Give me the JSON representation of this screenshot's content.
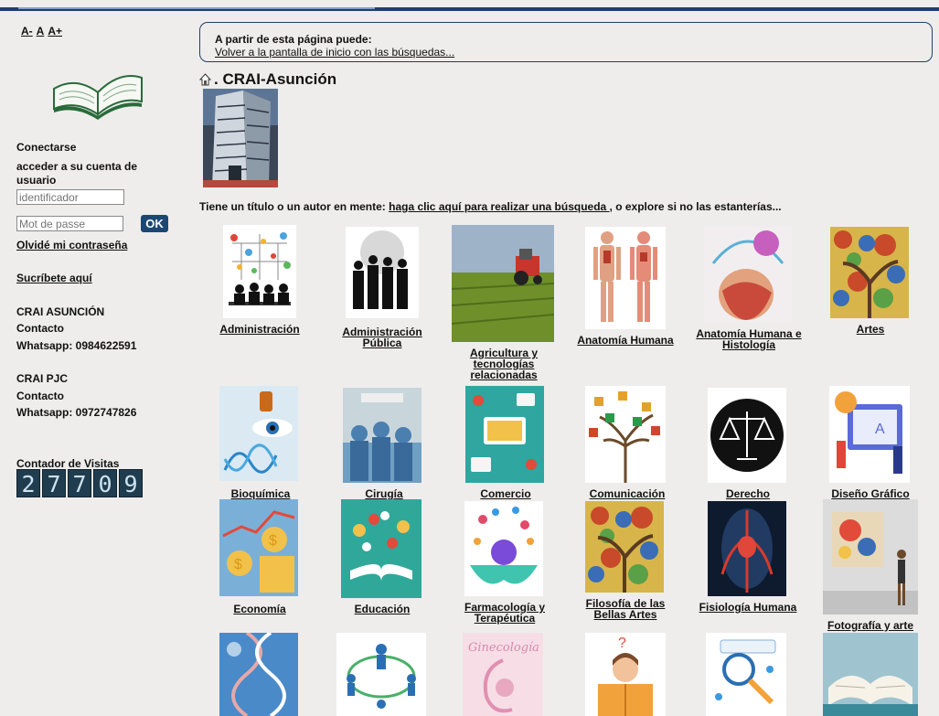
{
  "font_controls": {
    "small": "A-",
    "normal": "A",
    "large": "A+"
  },
  "sidebar": {
    "connect_title": "Conectarse",
    "connect_subtitle": "acceder a su cuenta de usuario",
    "username_placeholder": "identificador",
    "password_placeholder": "Mot de passe",
    "ok_label": "OK",
    "forgot_password": "Olvidé mi contraseña",
    "subscribe": "Sucríbete aquí",
    "contact1": {
      "name": "CRAI ASUNCIÓN",
      "label": "Contacto",
      "whatsapp": "Whatsapp: 0984622591"
    },
    "contact2": {
      "name": "CRAI PJC",
      "label": "Contacto",
      "whatsapp": "Whatsapp: 0972747826"
    },
    "visit_counter_title": "Contador de Visitas",
    "visit_counter_digits": [
      "2",
      "7",
      "7",
      "0",
      "9"
    ]
  },
  "info_box": {
    "text": "A partir de esta página puede:",
    "link": "Volver a la pantalla de inicio con las búsquedas..."
  },
  "page_title": ". CRAI-Asunción",
  "search_line": {
    "before": "Tiene un título o un autor en mente: ",
    "link": "haga clic aquí para realizar una búsqueda ",
    "after": ", o explore si no las estanterías..."
  },
  "categories": [
    {
      "label": "Administración",
      "icon": "business-people-icon"
    },
    {
      "label": "Administración Pública",
      "icon": "silhouettes-icon"
    },
    {
      "label": "Agricultura y tecnologías relacionadas",
      "icon": "tractor-icon"
    },
    {
      "label": "Anatomía Humana",
      "icon": "anatomy-icon"
    },
    {
      "label": "Anatomía Humana e Histología",
      "icon": "histology-icon"
    },
    {
      "label": "Artes",
      "icon": "art-tree-icon"
    },
    {
      "label": "Bioquímica",
      "icon": "dna-icon"
    },
    {
      "label": "Cirugía",
      "icon": "surgery-icon"
    },
    {
      "label": "Comercio",
      "icon": "commerce-icon"
    },
    {
      "label": "Comunicación",
      "icon": "communication-tree-icon"
    },
    {
      "label": "Derecho",
      "icon": "scales-icon"
    },
    {
      "label": "Diseño Gráfico",
      "icon": "graphic-design-icon"
    },
    {
      "label": "Economía",
      "icon": "economy-icon"
    },
    {
      "label": "Educación",
      "icon": "education-icon"
    },
    {
      "label": "Farmacología y Terapéutica",
      "icon": "pharmacology-icon"
    },
    {
      "label": "Filosofía de las Bellas Artes",
      "icon": "fine-arts-icon"
    },
    {
      "label": "Fisiología Humana",
      "icon": "physiology-icon"
    },
    {
      "label": "Fotografía y arte",
      "icon": "photography-icon"
    },
    {
      "label": "",
      "icon": "genetics-icon"
    },
    {
      "label": "",
      "icon": "network-icon"
    },
    {
      "label": "",
      "icon": "gynecology-icon"
    },
    {
      "label": "",
      "icon": "reading-child-icon"
    },
    {
      "label": "",
      "icon": "search-magnifier-icon"
    },
    {
      "label": "",
      "icon": "open-book-icon"
    }
  ]
}
